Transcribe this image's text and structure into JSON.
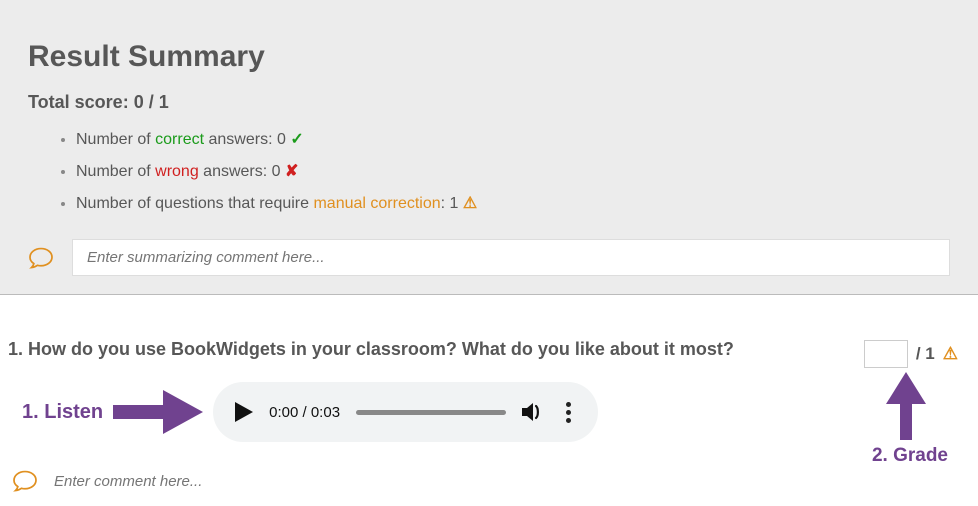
{
  "summary": {
    "title": "Result Summary",
    "total_label": "Total score:",
    "total_value": "0 / 1",
    "correct_prefix": "Number of ",
    "correct_word": "correct",
    "correct_suffix": " answers: 0 ",
    "wrong_prefix": "Number of ",
    "wrong_word": "wrong",
    "wrong_suffix": " answers: 0 ",
    "manual_prefix": "Number of questions that require ",
    "manual_word": "manual correction",
    "manual_suffix": ": 1 ",
    "comment_placeholder": "Enter summarizing comment here..."
  },
  "question": {
    "title": "1. How do you use BookWidgets in your classroom? What do you like about it most?",
    "listen_step": "1. Listen",
    "audio_time": "0:00 / 0:03",
    "comment_placeholder": "Enter comment here...",
    "grade_value": "",
    "grade_denom": "/ 1",
    "grade_step": "2. Grade"
  },
  "colors": {
    "accent_purple": "#70428f",
    "orange": "#e09020",
    "green": "#1b9b1b",
    "red": "#d02020"
  }
}
